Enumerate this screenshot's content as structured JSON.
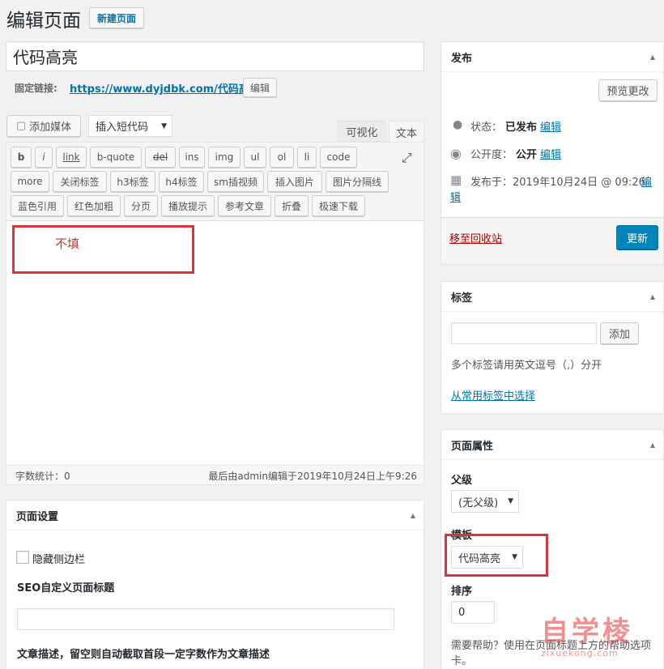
{
  "header": {
    "title": "编辑页面",
    "new_page_btn": "新建页面"
  },
  "post": {
    "title": "代码高亮",
    "permalink_label": "固定链接:",
    "permalink_url": "https://www.dyjdbk.com/代码高亮",
    "permalink_edit": "编辑"
  },
  "media": {
    "add_media": "添加媒体",
    "shortcode_select": "插入短代码"
  },
  "editor_tabs": {
    "visual": "可视化",
    "text": "文本"
  },
  "quicktags": {
    "row1": [
      "b",
      "i",
      "link",
      "b-quote",
      "del",
      "ins",
      "img",
      "ul",
      "ol",
      "li",
      "code"
    ],
    "row2": [
      "more",
      "关闭标签",
      "h3标签",
      "h4标签",
      "sm插视频",
      "插入图片",
      "图片分隔线"
    ],
    "row3": [
      "蓝色引用",
      "红色加粗",
      "分页",
      "播放提示",
      "参考文章",
      "折叠",
      "极速下载"
    ]
  },
  "editor": {
    "annotation": "不填",
    "word_count": "字数统计：0",
    "last_edited": "最后由admin编辑于2019年10月24日上午9:26"
  },
  "page_settings": {
    "title": "页面设置",
    "hide_sidebar": "隐藏侧边栏",
    "seo_title_label": "SEO自定义页面标题",
    "desc_label": "文章描述，留空则自动截取首段一定字数作为文章描述"
  },
  "publish": {
    "title": "发布",
    "preview_btn": "预览更改",
    "status_label": "状态：",
    "status_value": "已发布",
    "status_edit": "编辑",
    "visibility_label": "公开度：",
    "visibility_value": "公开",
    "visibility_edit": "编辑",
    "published_label": "发布于：2019年10月24日 @ 09:26",
    "published_edit_1": "编",
    "published_edit_2": "辑",
    "trash_link": "移至回收站",
    "update_btn": "更新"
  },
  "tags": {
    "title": "标签",
    "add_btn": "添加",
    "hint": "多个标签请用英文逗号（,）分开",
    "choose_link": "从常用标签中选择"
  },
  "page_attr": {
    "title": "页面属性",
    "parent_label": "父级",
    "parent_value": "(无父级)",
    "template_label": "模板",
    "template_value": "代码高亮",
    "order_label": "排序",
    "order_value": "0",
    "help_text_1": "需要帮助？使用在页面标题上方的帮助选项",
    "help_text_2": "卡。"
  },
  "watermark": {
    "text_cn": "自学棱",
    "text_en": "zixuekong.com"
  },
  "colors": {
    "link": "#0073aa",
    "primary": "#0085ba",
    "annotation_red": "#d63638",
    "trash_red": "#a00"
  }
}
